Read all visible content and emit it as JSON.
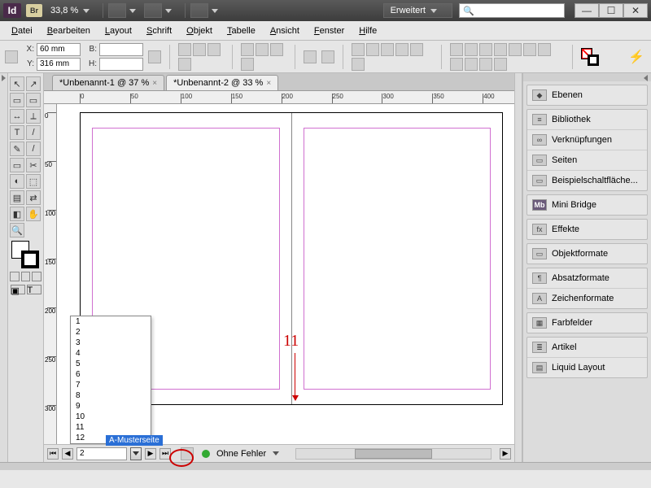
{
  "title": {
    "zoom": "33,8 %",
    "workspace": "Erweitert"
  },
  "menu": [
    "Datei",
    "Bearbeiten",
    "Layout",
    "Schrift",
    "Objekt",
    "Tabelle",
    "Ansicht",
    "Fenster",
    "Hilfe"
  ],
  "menu_accel": [
    "D",
    "B",
    "L",
    "S",
    "O",
    "T",
    "A",
    "F",
    "H"
  ],
  "control": {
    "x_label": "X:",
    "y_label": "Y:",
    "w_label": "B:",
    "h_label": "H:",
    "x": "60 mm",
    "y": "316 mm",
    "w": "",
    "h": ""
  },
  "tabs": [
    {
      "label": "*Unbenannt-1 @ 37 %",
      "active": false
    },
    {
      "label": "*Unbenannt-2 @ 33 %",
      "active": true
    }
  ],
  "hruler_marks": [
    0,
    50,
    100,
    150,
    200,
    250,
    300,
    350,
    400
  ],
  "vruler_marks": [
    0,
    50,
    100,
    150,
    200,
    250,
    300
  ],
  "page_dropdown": {
    "selected_master": "A-Musterseite",
    "items": [
      "1",
      "2",
      "3",
      "4",
      "5",
      "6",
      "7",
      "8",
      "9",
      "10",
      "11",
      "12"
    ]
  },
  "annotation": {
    "label": "11"
  },
  "status": {
    "page": "2",
    "preflight": "Ohne Fehler"
  },
  "panels": [
    [
      {
        "icon": "layers",
        "label": "Ebenen"
      }
    ],
    [
      {
        "icon": "books",
        "label": "Bibliothek"
      },
      {
        "icon": "links",
        "label": "Verknüpfungen"
      },
      {
        "icon": "pages",
        "label": "Seiten"
      },
      {
        "icon": "buttons",
        "label": "Beispielschaltfläche..."
      }
    ],
    [
      {
        "icon": "mb",
        "label": "Mini Bridge"
      }
    ],
    [
      {
        "icon": "fx",
        "label": "Effekte"
      }
    ],
    [
      {
        "icon": "objstyle",
        "label": "Objektformate"
      }
    ],
    [
      {
        "icon": "parastyle",
        "label": "Absatzformate"
      },
      {
        "icon": "charstyle",
        "label": "Zeichenformate"
      }
    ],
    [
      {
        "icon": "swatch",
        "label": "Farbfelder"
      }
    ],
    [
      {
        "icon": "article",
        "label": "Artikel"
      },
      {
        "icon": "liquid",
        "label": "Liquid Layout"
      }
    ]
  ],
  "panel_icon_glyph": {
    "layers": "◆",
    "books": "≡",
    "links": "∞",
    "pages": "▭",
    "buttons": "▭",
    "mb": "Mb",
    "fx": "fx",
    "objstyle": "▭",
    "parastyle": "¶",
    "charstyle": "A",
    "swatch": "▦",
    "article": "≣",
    "liquid": "▤"
  },
  "tools": [
    "↖",
    "↗",
    "▭",
    "▭",
    "↔",
    "⟂",
    "T",
    "/",
    "✎",
    "/",
    "▭",
    "✂",
    "◐",
    "⬚",
    "▤",
    "⇄",
    "◧",
    "✋",
    "🔍"
  ]
}
